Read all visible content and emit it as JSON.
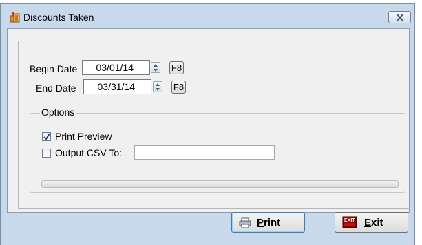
{
  "window": {
    "title": "Discounts Taken",
    "icon": "ledger-icon",
    "close_icon": "close-icon"
  },
  "dates": {
    "begin_label": "Begin Date",
    "begin_value": "03/01/14",
    "end_label": "End Date",
    "end_value": "03/31/14",
    "lookup_key_label": "F8"
  },
  "options": {
    "group_label": "Options",
    "print_preview_label": "Print Preview",
    "print_preview_checked": true,
    "output_csv_label": "Output CSV To:",
    "output_csv_checked": false,
    "output_csv_path": ""
  },
  "progress": {
    "fraction": 0
  },
  "buttons": {
    "print_label": "Print",
    "print_icon": "printer-icon",
    "exit_label": "Exit",
    "exit_icon": "exit-sign-icon"
  },
  "colors": {
    "window_frame": "#c9d9ec",
    "client_bg": "#f0f0f0",
    "progress_fill": "#41c24a"
  }
}
